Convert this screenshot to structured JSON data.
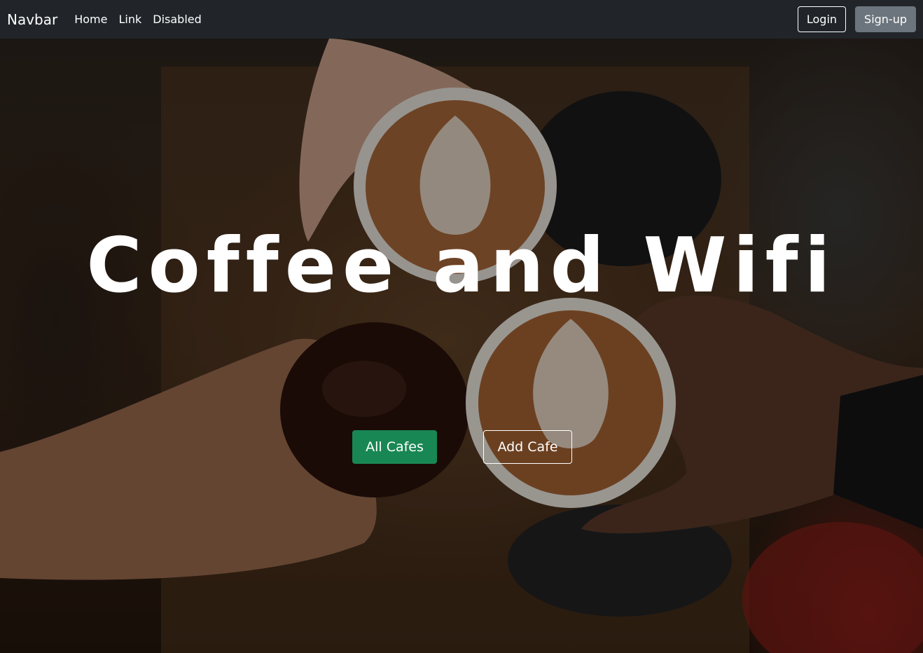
{
  "navbar": {
    "brand": "Navbar",
    "links": [
      {
        "label": "Home"
      },
      {
        "label": "Link"
      },
      {
        "label": "Disabled"
      }
    ],
    "login_label": "Login",
    "signup_label": "Sign-up"
  },
  "hero": {
    "headline": "Coffee and Wifi",
    "all_cafes_label": "All Cafes",
    "add_cafe_label": "Add Cafe"
  },
  "colors": {
    "navbar_bg": "#212529",
    "primary_cta": "#198754",
    "secondary_button": "#6c757d",
    "text": "#ffffff"
  }
}
